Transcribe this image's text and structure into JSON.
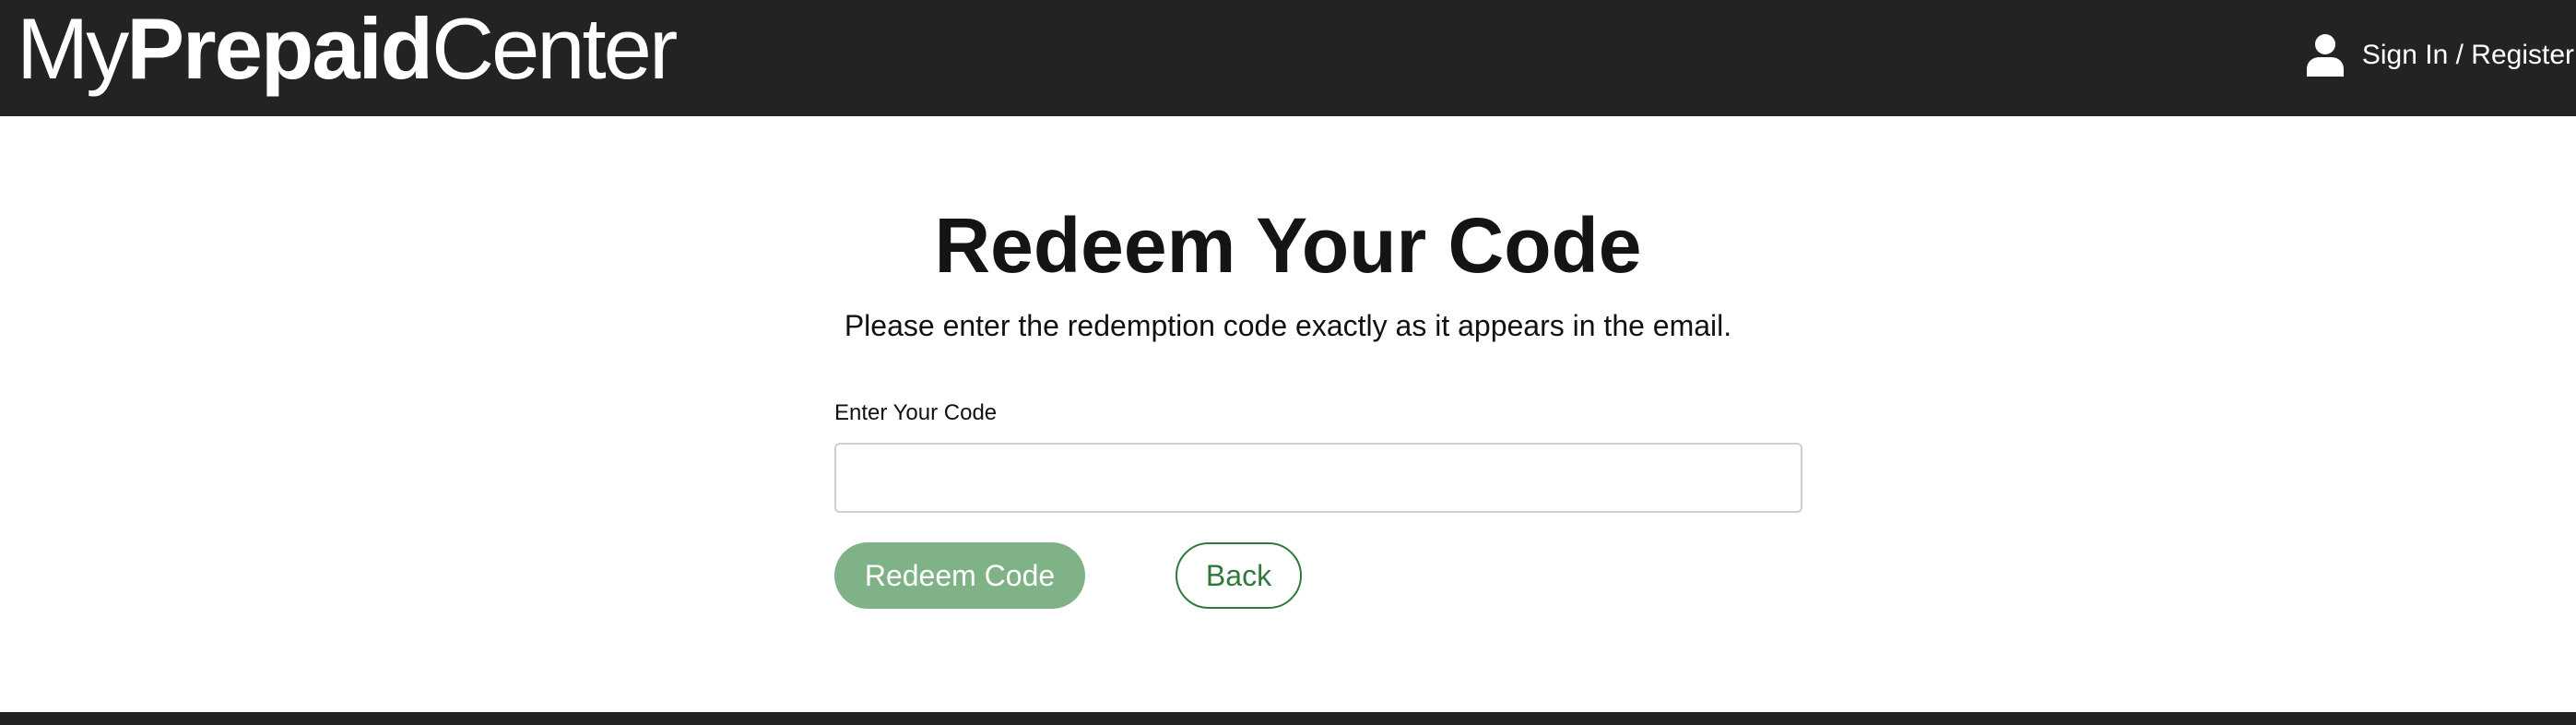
{
  "header": {
    "logo": {
      "part_my": "My",
      "part_prepaid": "Prepaid",
      "part_center": "Center"
    },
    "signin_label": "Sign In / Register",
    "signin_icon": "user-icon"
  },
  "main": {
    "title": "Redeem Your Code",
    "subtitle": "Please enter the redemption code exactly as it appears in the email.",
    "code_field": {
      "label": "Enter Your Code",
      "value": "",
      "placeholder": ""
    },
    "redeem_button": "Redeem Code",
    "back_button": "Back"
  },
  "colors": {
    "header_bg": "#232323",
    "redeem_button_bg": "#7fb387",
    "back_button_accent": "#2f7a3a"
  }
}
